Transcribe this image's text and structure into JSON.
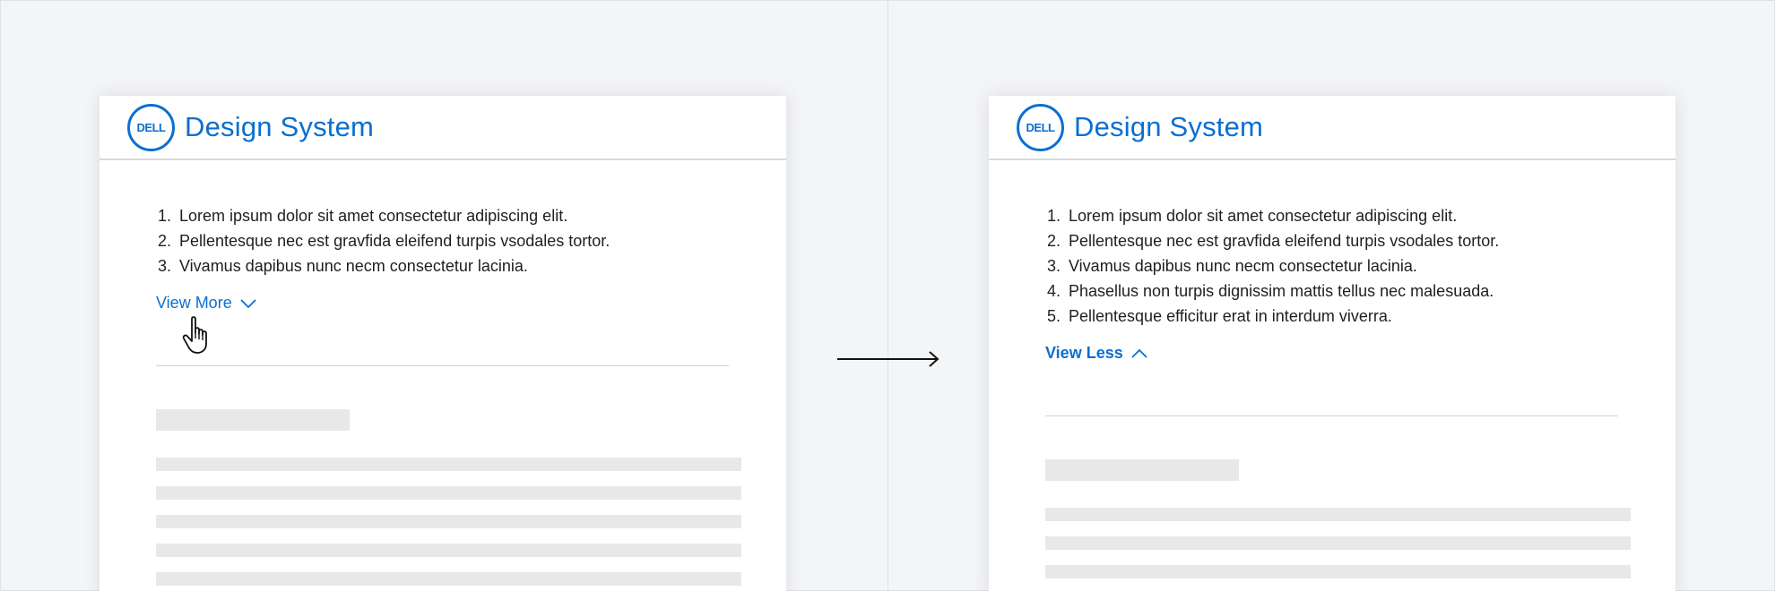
{
  "cards": {
    "before": {
      "logo_text": "DELL",
      "title": "Design System",
      "items": [
        "Lorem ipsum dolor sit amet consectetur adipiscing elit.",
        "Pellentesque nec est gravfida eleifend turpis vsodales tortor.",
        "Vivamus dapibus nunc necm consectetur lacinia."
      ],
      "toggle_label": "View More",
      "toggle_icon": "chevron-down-icon"
    },
    "after": {
      "logo_text": "DELL",
      "title": "Design System",
      "items": [
        "Lorem ipsum dolor sit amet consectetur adipiscing elit.",
        "Pellentesque nec est gravfida eleifend turpis vsodales tortor.",
        "Vivamus dapibus nunc necm consectetur lacinia.",
        "Phasellus non turpis dignissim mattis tellus nec malesuada.",
        "Pellentesque efficitur erat in interdum viverra."
      ],
      "toggle_label": "View Less",
      "toggle_icon": "chevron-up-icon"
    }
  },
  "numbers": [
    "1.",
    "2.",
    "3.",
    "4.",
    "5."
  ],
  "colors": {
    "brand": "#0a6fd0",
    "text": "#1f1f1f",
    "skeleton": "#e8e8e8",
    "background": "#f4f5f7"
  }
}
